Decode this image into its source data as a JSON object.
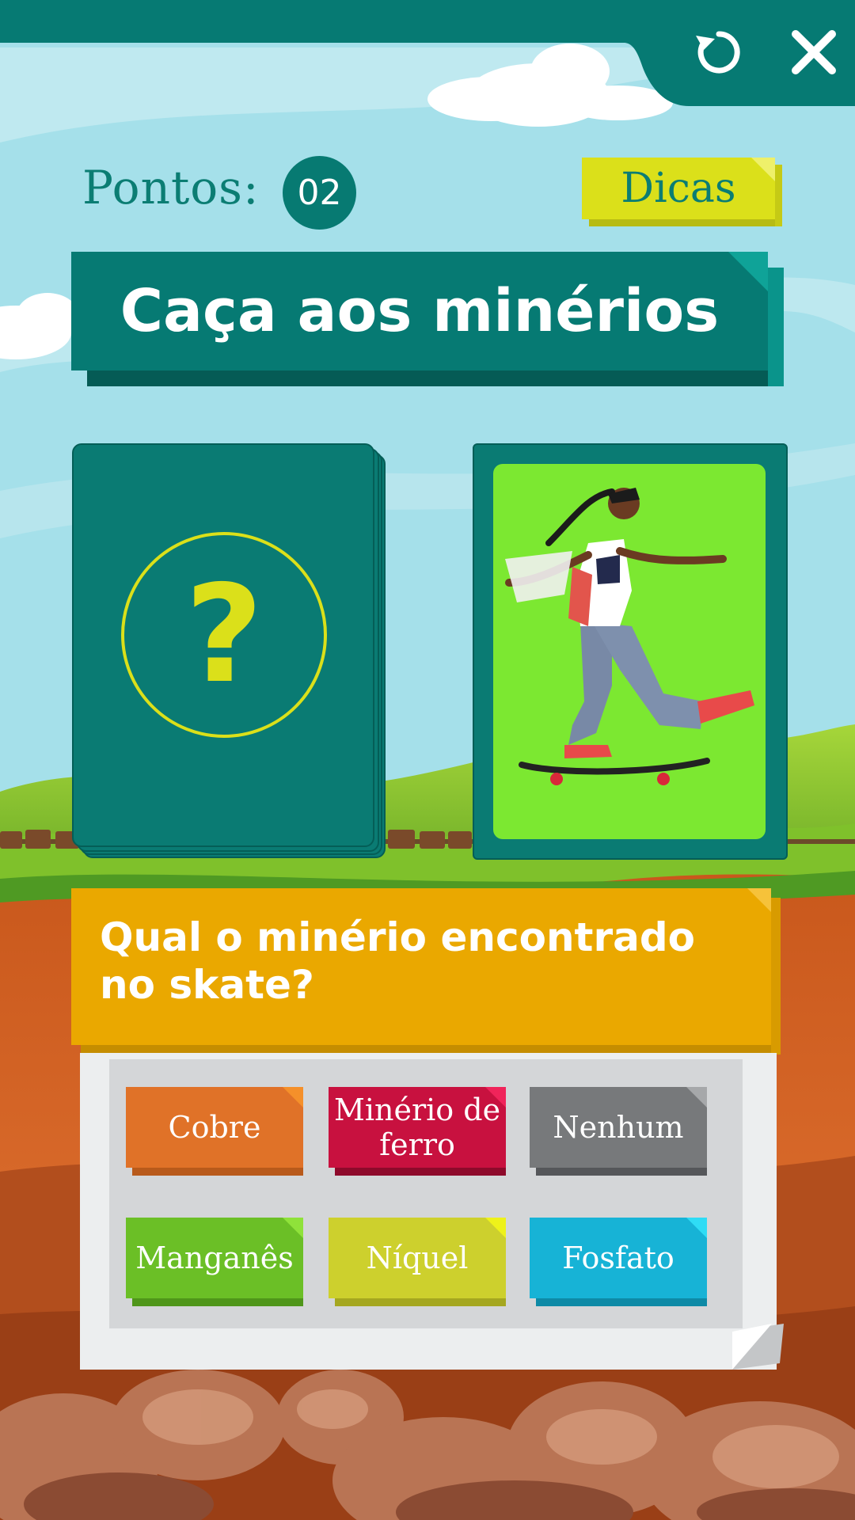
{
  "header": {
    "restart_icon": "restart-icon",
    "close_icon": "close-icon"
  },
  "score": {
    "label": "Pontos:",
    "value": "02"
  },
  "hints": {
    "label": "Dicas"
  },
  "title": "Caça aos minérios",
  "cards": {
    "mystery_symbol": "?",
    "image_subject": "skate"
  },
  "question": "Qual o minério encontrado no skate?",
  "answers": [
    {
      "label": "Cobre",
      "color": "#e07228",
      "shade": "#b85a1b",
      "corner": "#f5902a"
    },
    {
      "label": "Minério de ferro",
      "color": "#c8113f",
      "shade": "#8e0a2b",
      "corner": "#f0245a"
    },
    {
      "label": "Nenhum",
      "color": "#77797b",
      "shade": "#55575a",
      "corner": "#a6a8aa"
    },
    {
      "label": "Manganês",
      "color": "#6bbf26",
      "shade": "#4f961a",
      "corner": "#8fe23a"
    },
    {
      "label": "Níquel",
      "color": "#cdd02d",
      "shade": "#a5a720",
      "corner": "#eef21a"
    },
    {
      "label": "Fosfato",
      "color": "#17b3d6",
      "shade": "#0e8aa6",
      "corner": "#2fdcf5"
    }
  ],
  "colors": {
    "teal": "#067a73",
    "sky": "#a5e0ea",
    "hints_yellow": "#dbe01a",
    "question_orange": "#eaa800"
  }
}
